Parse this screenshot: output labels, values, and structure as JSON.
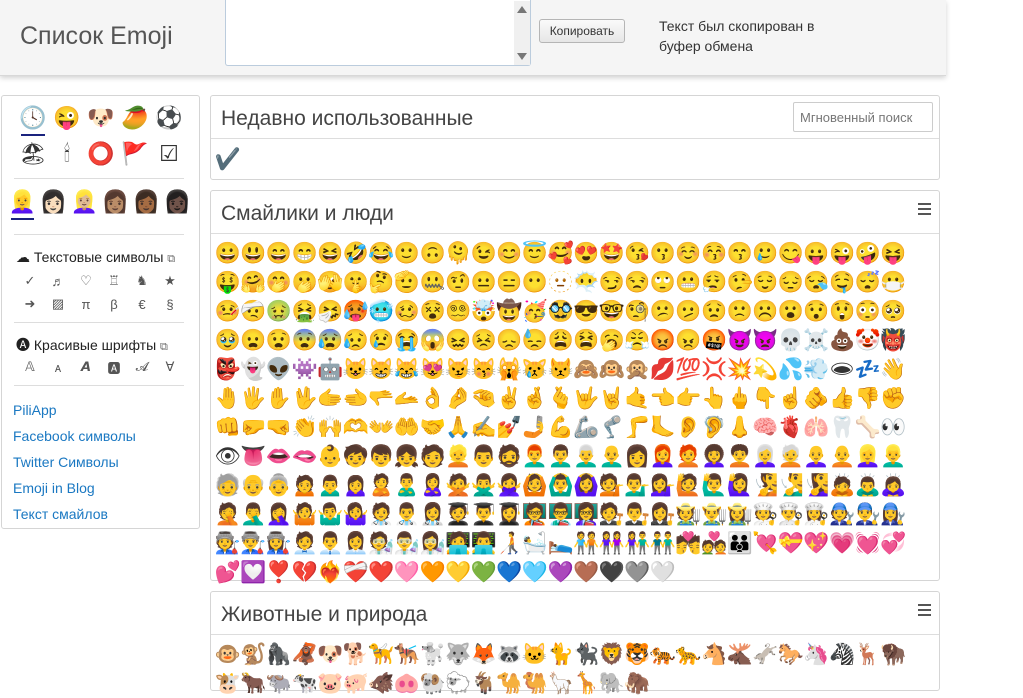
{
  "header": {
    "logo": "Список Emoji",
    "copy_button": "Копировать",
    "copy_message": "Текст был скопирован в буфер обмена"
  },
  "sidebar": {
    "categories": [
      "🕓",
      "😜",
      "🐶",
      "🥭",
      "⚽",
      "🏖",
      "🕯",
      "⭕",
      "🚩",
      "☑"
    ],
    "skin_tones": [
      "👱‍♀️",
      "👩🏻",
      "👱🏼‍♀️",
      "👩🏽",
      "👩🏾",
      "👩🏿"
    ],
    "text_symbols_title": "Текстовые символы",
    "text_symbols": [
      "✓",
      "♬",
      "♡",
      "♖",
      "♞",
      "★",
      "➜",
      "▨",
      "π",
      "β",
      "€",
      "§"
    ],
    "fonts_title": "Красивые шрифты",
    "fonts": [
      "𝔸",
      "ᴀ",
      "𝘼",
      "🅰",
      "𝓐",
      "∀"
    ],
    "links": [
      "PiliApp",
      "Facebook символы",
      "Twitter Символы",
      "Emoji in Blog",
      "Текст смайлов"
    ]
  },
  "recent": {
    "title": "Недавно использованные",
    "search_placeholder": "Мгновенный поиск",
    "emojis": [
      "✔️"
    ]
  },
  "smileys": {
    "title": "Смайлики и люди",
    "emojis": [
      "😀",
      "😃",
      "😄",
      "😁",
      "😆",
      "🤣",
      "😂",
      "🙂",
      "🙃",
      "🫠",
      "😉",
      "😊",
      "😇",
      "🥰",
      "😍",
      "🤩",
      "😘",
      "😗",
      "☺️",
      "😚",
      "😙",
      "🥲",
      "😋",
      "😛",
      "😜",
      "🤪",
      "😝",
      "🤑",
      "🤗",
      "🤭",
      "🫢",
      "🫣",
      "🤫",
      "🤔",
      "🫡",
      "🤐",
      "🤨",
      "😐",
      "😑",
      "😶",
      "🫥",
      "😶‍🌫️",
      "😏",
      "😒",
      "🙄",
      "😬",
      "😮‍💨",
      "🤥",
      "😌",
      "😔",
      "😪",
      "🤤",
      "😴",
      "😷",
      "🤒",
      "🤕",
      "🤢",
      "🤮",
      "🤧",
      "🥵",
      "🥶",
      "🥴",
      "😵",
      "😵‍💫",
      "🤯",
      "🤠",
      "🥳",
      "🥸",
      "😎",
      "🤓",
      "🧐",
      "😕",
      "🫤",
      "😟",
      "🙁",
      "☹️",
      "😮",
      "😯",
      "😲",
      "😳",
      "🥺",
      "🥹",
      "😦",
      "😧",
      "😨",
      "😰",
      "😥",
      "😢",
      "😭",
      "😱",
      "😖",
      "😣",
      "😞",
      "😓",
      "😩",
      "😫",
      "🥱",
      "😤",
      "😡",
      "😠",
      "🤬",
      "😈",
      "👿",
      "💀",
      "☠️",
      "💩",
      "🤡",
      "👹",
      "👺",
      "👻",
      "👽",
      "👾",
      "🤖",
      "😺",
      "😸",
      "😹",
      "😻",
      "😼",
      "😽",
      "🙀",
      "😿",
      "😾",
      "🙈",
      "🙉",
      "🙊",
      "💋",
      "💯",
      "💢",
      "💥",
      "💫",
      "💦",
      "💨",
      "🕳",
      "💤",
      "👋",
      "🤚",
      "🖐",
      "✋",
      "🖖",
      "🫱",
      "🫲",
      "🫳",
      "🫴",
      "👌",
      "🤌",
      "🤏",
      "✌️",
      "🤞",
      "🫰",
      "🤟",
      "🤘",
      "🤙",
      "👈",
      "👉",
      "👆",
      "🖕",
      "👇",
      "☝️",
      "🫵",
      "👍",
      "👎",
      "✊",
      "👊",
      "🤛",
      "🤜",
      "👏",
      "🙌",
      "🫶",
      "👐",
      "🤲",
      "🤝",
      "🙏",
      "✍️",
      "💅",
      "🤳",
      "💪",
      "🦾",
      "🦿",
      "🦵",
      "🦶",
      "👂",
      "🦻",
      "👃",
      "🧠",
      "🫀",
      "🫁",
      "🦷",
      "🦴",
      "👀",
      "👁",
      "👅",
      "👄",
      "🫦",
      "👶",
      "🧒",
      "👦",
      "👧",
      "🧑",
      "👱",
      "👨",
      "🧔",
      "👨‍🦰",
      "👨‍🦱",
      "👨‍🦳",
      "👨‍🦲",
      "👩",
      "👩‍🦰",
      "🧑‍🦰",
      "👩‍🦱",
      "🧑‍🦱",
      "👩‍🦳",
      "🧑‍🦳",
      "👩‍🦲",
      "🧑‍🦲",
      "👱‍♀️",
      "👱‍♂️",
      "🧓",
      "👴",
      "👵",
      "🙍",
      "🙍‍♂️",
      "🙍‍♀️",
      "🙎",
      "🙎‍♂️",
      "🙎‍♀️",
      "🙅",
      "🙅‍♂️",
      "🙅‍♀️",
      "🙆",
      "🙆‍♂️",
      "🙆‍♀️",
      "💁",
      "💁‍♂️",
      "💁‍♀️",
      "🙋",
      "🙋‍♂️",
      "🙋‍♀️",
      "🧏",
      "🧏‍♂️",
      "🧏‍♀️",
      "🙇",
      "🙇‍♂️",
      "🙇‍♀️",
      "🤦",
      "🤦‍♂️",
      "🤦‍♀️",
      "🤷",
      "🤷‍♂️",
      "🤷‍♀️",
      "🧑‍⚕️",
      "👨‍⚕️",
      "👩‍⚕️",
      "🧑‍🎓",
      "👨‍🎓",
      "👩‍🎓",
      "🧑‍🏫",
      "👨‍🏫",
      "👩‍🏫",
      "🧑‍⚖️",
      "👨‍⚖️",
      "👩‍⚖️",
      "🧑‍🌾",
      "👨‍🌾",
      "👩‍🌾",
      "🧑‍🍳",
      "👨‍🍳",
      "👩‍🍳",
      "🧑‍🔧",
      "👨‍🔧",
      "👩‍🔧",
      "🧑‍🏭",
      "👨‍🏭",
      "👩‍🏭",
      "🧑‍💼",
      "👨‍💼",
      "👩‍💼",
      "🧑‍🔬",
      "👨‍🔬",
      "👩‍🔬",
      "🧑‍💻",
      "👨‍💻",
      "🧑‍🦯",
      "🛀",
      "🛌",
      "🧑‍🤝‍🧑",
      "👭",
      "👫",
      "👬",
      "💏",
      "💑",
      "👪",
      "💘",
      "💝",
      "💖",
      "💗",
      "💓",
      "💞",
      "💕",
      "💟",
      "❣️",
      "💔",
      "❤️‍🔥",
      "❤️‍🩹",
      "❤️",
      "🩷",
      "🧡",
      "💛",
      "💚",
      "💙",
      "🩵",
      "💜",
      "🤎",
      "🖤",
      "🩶",
      "🤍"
    ]
  },
  "animals": {
    "title": "Животные и природа",
    "emojis": [
      "🐵",
      "🐒",
      "🦍",
      "🦧",
      "🐶",
      "🐕",
      "🦮",
      "🐕‍🦺",
      "🐩",
      "🐺",
      "🦊",
      "🦝",
      "🐱",
      "🐈",
      "🐈‍⬛",
      "🦁",
      "🐯",
      "🐅",
      "🐆",
      "🐴",
      "🫎",
      "🫏",
      "🐎",
      "🦄",
      "🦓",
      "🦌",
      "🦬",
      "🐮",
      "🐂",
      "🐃",
      "🐄",
      "🐷",
      "🐖",
      "🐗",
      "🐽",
      "🐏",
      "🐑",
      "🐐",
      "🐪",
      "🐫",
      "🦙",
      "🦒",
      "🐘",
      "🦣"
    ]
  }
}
